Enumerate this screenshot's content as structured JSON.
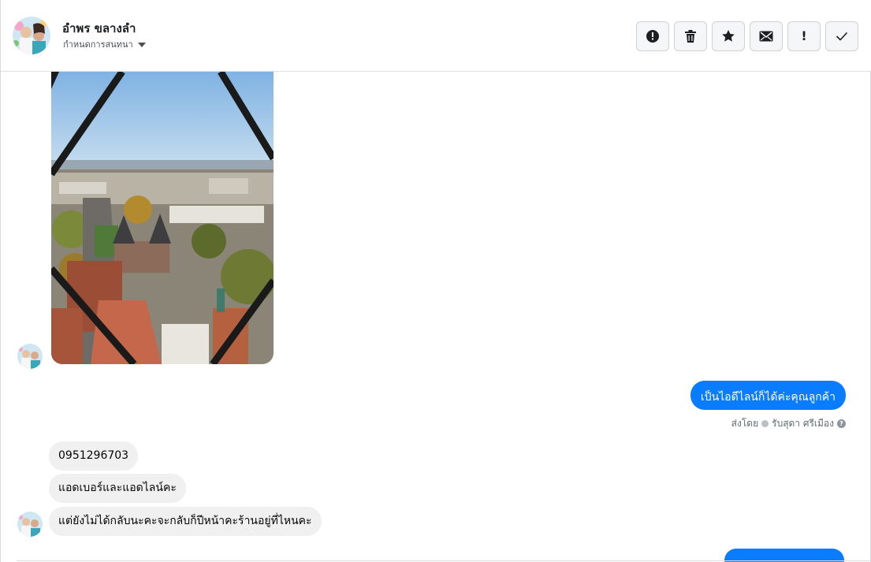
{
  "header": {
    "contact_name": "อำพร ขลางลำ",
    "assign_label": "กำหนดการสนทนา"
  },
  "toolbar": {
    "buttons": [
      {
        "icon": "alert-circle-icon",
        "name": "spam-button"
      },
      {
        "icon": "trash-icon",
        "name": "delete-button"
      },
      {
        "icon": "star-icon",
        "name": "star-button"
      },
      {
        "icon": "envelope-icon",
        "name": "mark-unread-button"
      },
      {
        "icon": "exclamation-icon",
        "name": "follow-up-button"
      },
      {
        "icon": "check-icon",
        "name": "done-button"
      }
    ]
  },
  "messages": {
    "outgoing_1": "เป็นไอดีไลน์ก็ได้ค่ะคุณลูกค้า",
    "sent_by_prefix": "ส่งโดย",
    "sent_by_name": "รับสุดา ศรีเมือง",
    "incoming_1": "0951296703",
    "incoming_2": "แอดเบอร์และแอดไลน์คะ",
    "incoming_3": "แต่ยังไม่ได้กลับนะคะจะกลับก็ปีหน้าคะร้านอยู่ที่ไหนคะ"
  },
  "colors": {
    "accent": "#0a7cff",
    "incoming_bubble": "#f0f0f0"
  }
}
